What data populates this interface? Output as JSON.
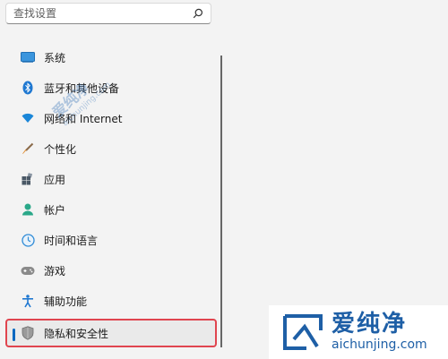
{
  "search": {
    "placeholder": "查找设置",
    "icon": "search-icon"
  },
  "sidebar": {
    "items": [
      {
        "label": "系统",
        "icon": "system-monitor-icon",
        "color": "#2f8bd6"
      },
      {
        "label": "蓝牙和其他设备",
        "icon": "bluetooth-icon",
        "color": "#1f78d1"
      },
      {
        "label": "网络和 Internet",
        "icon": "wifi-icon",
        "color": "#1a86d8"
      },
      {
        "label": "个性化",
        "icon": "paintbrush-icon",
        "color": "#d98a3a"
      },
      {
        "label": "应用",
        "icon": "apps-icon",
        "color": "#5a6c7d"
      },
      {
        "label": "帐户",
        "icon": "account-icon",
        "color": "#2aa889"
      },
      {
        "label": "时间和语言",
        "icon": "clock-globe-icon",
        "color": "#2f8bd6"
      },
      {
        "label": "游戏",
        "icon": "gamepad-icon",
        "color": "#6b6b6b"
      },
      {
        "label": "辅助功能",
        "icon": "accessibility-icon",
        "color": "#1f78d1"
      },
      {
        "label": "隐私和安全性",
        "icon": "shield-icon",
        "color": "#7a7a7a",
        "selected": true
      }
    ]
  },
  "watermark": {
    "side_title": "爱纯净",
    "side_url": "aichunjing.com",
    "box_title": "爱纯净",
    "box_url": "aichunjing.com",
    "color": "#1e5fa6"
  },
  "colors": {
    "accent": "#0067c0",
    "highlight_border": "#e0454f"
  }
}
